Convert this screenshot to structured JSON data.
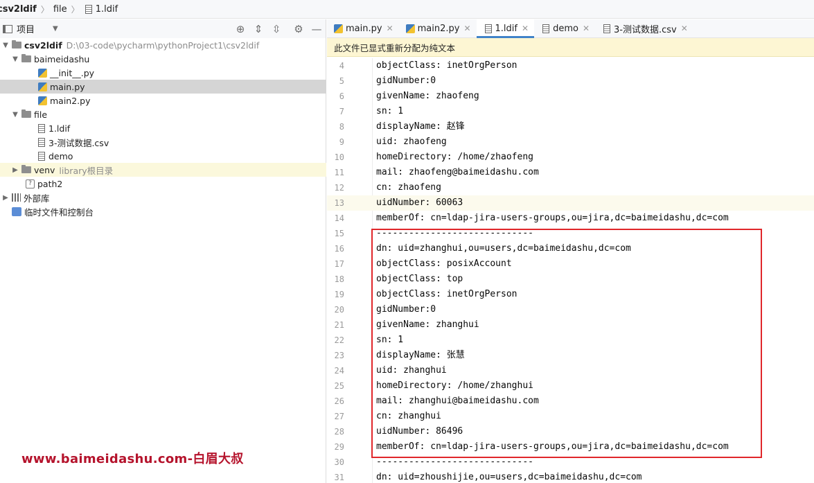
{
  "breadcrumb": [
    "csv2ldif",
    "file",
    "1.ldif"
  ],
  "project_panel": {
    "title": "项目",
    "tree": [
      {
        "label": "csv2ldif",
        "hint": "D:\\03-code\\pycharm\\pythonProject1\\csv2ldif",
        "type": "folder",
        "level": 0,
        "expanded": true
      },
      {
        "label": "baimeidashu",
        "type": "folder",
        "level": 1,
        "expanded": true
      },
      {
        "label": "__init__.py",
        "type": "py",
        "level": 2
      },
      {
        "label": "main.py",
        "type": "py",
        "level": 2,
        "selected": true
      },
      {
        "label": "main2.py",
        "type": "py",
        "level": 2
      },
      {
        "label": "file",
        "type": "folder",
        "level": 1,
        "expanded": true
      },
      {
        "label": "1.ldif",
        "type": "txt",
        "level": 2
      },
      {
        "label": "3-测试数据.csv",
        "type": "txt",
        "level": 2
      },
      {
        "label": "demo",
        "type": "txt",
        "level": 2
      },
      {
        "label": "venv",
        "hint": "library根目录",
        "type": "folder",
        "level": 1,
        "expanded": false,
        "highlight": true
      },
      {
        "label": "path2",
        "type": "path",
        "level": 1
      },
      {
        "label": "外部库",
        "type": "lib",
        "level": 0,
        "expanded": false
      },
      {
        "label": "临时文件和控制台",
        "type": "scratch",
        "level": 0
      }
    ]
  },
  "editor": {
    "tabs": [
      {
        "label": "main.py",
        "icon": "python-file-icon"
      },
      {
        "label": "main2.py",
        "icon": "python-file-icon"
      },
      {
        "label": "1.ldif",
        "icon": "text-file-icon",
        "active": true
      },
      {
        "label": "demo",
        "icon": "text-file-icon"
      },
      {
        "label": "3-测试数据.csv",
        "icon": "text-file-icon"
      }
    ],
    "notice": "此文件已显式重新分配为纯文本",
    "current_line": 13,
    "lines": [
      {
        "n": "4",
        "text": "objectClass: inetOrgPerson"
      },
      {
        "n": "5",
        "text": "gidNumber:0"
      },
      {
        "n": "6",
        "text": "givenName: zhaofeng"
      },
      {
        "n": "7",
        "text": "sn: 1"
      },
      {
        "n": "8",
        "text": "displayName: 赵锋"
      },
      {
        "n": "9",
        "text": "uid: zhaofeng"
      },
      {
        "n": "10",
        "text": "homeDirectory: /home/zhaofeng"
      },
      {
        "n": "11",
        "text": "mail: zhaofeng@baimeidashu.com"
      },
      {
        "n": "12",
        "text": "cn: zhaofeng"
      },
      {
        "n": "13",
        "text": "uidNumber: 60063"
      },
      {
        "n": "14",
        "text": "memberOf: cn=ldap-jira-users-groups,ou=jira,dc=baimeidashu,dc=com"
      },
      {
        "n": "15",
        "text": "-----------------------------"
      },
      {
        "n": "16",
        "text": "dn: uid=zhanghui,ou=users,dc=baimeidashu,dc=com"
      },
      {
        "n": "17",
        "text": "objectClass: posixAccount"
      },
      {
        "n": "18",
        "text": "objectClass: top"
      },
      {
        "n": "19",
        "text": "objectClass: inetOrgPerson"
      },
      {
        "n": "20",
        "text": "gidNumber:0"
      },
      {
        "n": "21",
        "text": "givenName: zhanghui"
      },
      {
        "n": "22",
        "text": "sn: 1"
      },
      {
        "n": "23",
        "text": "displayName: 张慧"
      },
      {
        "n": "24",
        "text": "uid: zhanghui"
      },
      {
        "n": "25",
        "text": "homeDirectory: /home/zhanghui"
      },
      {
        "n": "26",
        "text": "mail: zhanghui@baimeidashu.com"
      },
      {
        "n": "27",
        "text": "cn: zhanghui"
      },
      {
        "n": "28",
        "text": "uidNumber: 86496"
      },
      {
        "n": "29",
        "text": "memberOf: cn=ldap-jira-users-groups,ou=jira,dc=baimeidashu,dc=com"
      },
      {
        "n": "30",
        "text": "-----------------------------"
      },
      {
        "n": "31",
        "text": "dn: uid=zhoushijie,ou=users,dc=baimeidashu,dc=com"
      }
    ]
  },
  "watermark": "www.baimeidashu.com-白眉大叔",
  "colors": {
    "highlight_box": "#e0262a",
    "tab_accent": "#4083c9",
    "notice_bg": "#fdf6d3",
    "watermark": "#b5132c"
  }
}
